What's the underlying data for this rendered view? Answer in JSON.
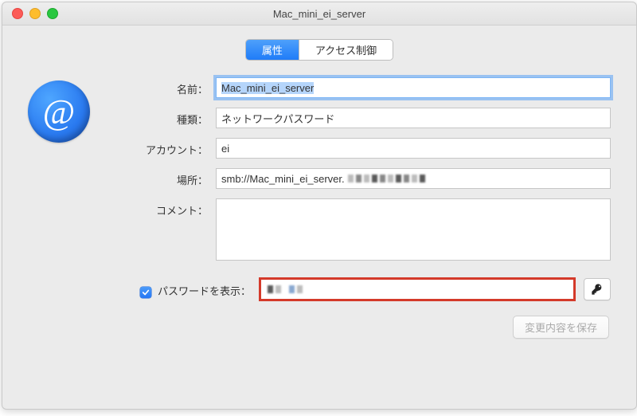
{
  "window": {
    "title": "Mac_mini_ei_server"
  },
  "tabs": {
    "attributes": "属性",
    "access_control": "アクセス制御"
  },
  "avatar": {
    "glyph": "@"
  },
  "labels": {
    "name": "名前：",
    "kind": "種類：",
    "account": "アカウント：",
    "location": "場所：",
    "comment": "コメント：",
    "show_password": "パスワードを表示："
  },
  "fields": {
    "name": "Mac_mini_ei_server",
    "kind": "ネットワークパスワード",
    "account": "ei",
    "location_prefix": "smb://Mac_mini_ei_server.",
    "comment": ""
  },
  "show_password_checked": true,
  "buttons": {
    "save": "変更内容を保存",
    "key_glyph": "🔑"
  }
}
